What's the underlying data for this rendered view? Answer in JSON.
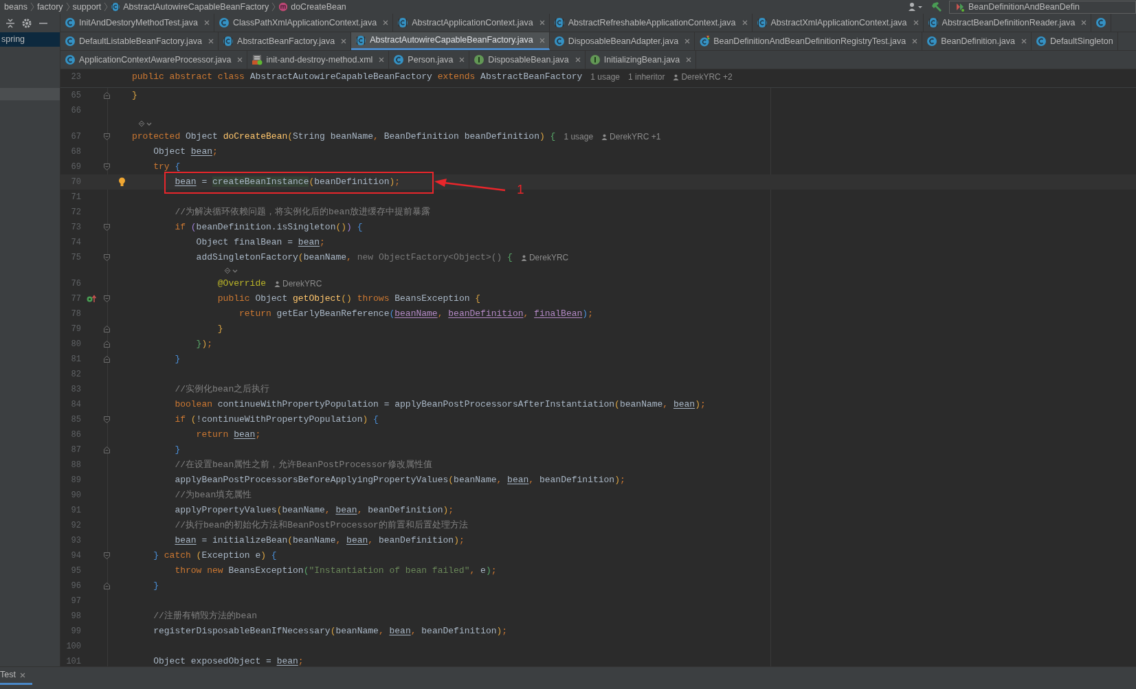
{
  "breadcrumb": [
    {
      "label": "beans"
    },
    {
      "label": "factory"
    },
    {
      "label": "support"
    },
    {
      "label": "AbstractAutowireCapableBeanFactory",
      "kind": "abstract"
    },
    {
      "label": "doCreateBean",
      "kind": "method"
    }
  ],
  "toolbar": {
    "run_config": "BeanDefinitionAndBeanDefin"
  },
  "project_panel": {
    "items": [
      {
        "label": "spring",
        "selected": true
      }
    ]
  },
  "tab_rows": [
    [
      {
        "label": "InitAndDestoryMethodTest.java",
        "kind": "class",
        "selected": false
      },
      {
        "label": "ClassPathXmlApplicationContext.java",
        "kind": "class",
        "selected": false
      },
      {
        "label": "AbstractApplicationContext.java",
        "kind": "abstract",
        "selected": false
      },
      {
        "label": "AbstractRefreshableApplicationContext.java",
        "kind": "abstract",
        "selected": false
      },
      {
        "label": "AbstractXmlApplicationContext.java",
        "kind": "abstract",
        "selected": false
      },
      {
        "label": "AbstractBeanDefinitionReader.java",
        "kind": "abstract",
        "selected": false
      },
      {
        "kind": "class",
        "selected": false
      }
    ],
    [
      {
        "label": "DefaultListableBeanFactory.java",
        "kind": "class",
        "selected": false
      },
      {
        "label": "AbstractBeanFactory.java",
        "kind": "abstract",
        "selected": false
      },
      {
        "label": "AbstractAutowireCapableBeanFactory.java",
        "kind": "abstract",
        "selected": true
      },
      {
        "label": "DisposableBeanAdapter.java",
        "kind": "class",
        "selected": false
      },
      {
        "label": "BeanDefinitionAndBeanDefinitionRegistryTest.java",
        "kind": "test",
        "selected": false
      },
      {
        "label": "BeanDefinition.java",
        "kind": "class",
        "selected": false
      },
      {
        "label": "DefaultSingleton",
        "kind": "class",
        "selected": false
      }
    ],
    [
      {
        "label": "ApplicationContextAwareProcessor.java",
        "kind": "class",
        "selected": false
      },
      {
        "label": "init-and-destroy-method.xml",
        "kind": "xml",
        "selected": false
      },
      {
        "label": "Person.java",
        "kind": "class",
        "selected": false
      },
      {
        "label": "DisposableBean.java",
        "kind": "interface",
        "selected": false
      },
      {
        "label": "InitializingBean.java",
        "kind": "interface",
        "selected": false
      }
    ]
  ],
  "editor": {
    "sticky_lines": [
      {
        "number": "23",
        "tokens": [
          {
            "kind": "keyword",
            "text": "public abstract class "
          },
          {
            "kind": "plain",
            "text": "AbstractAutowireCapableBeanFactory "
          },
          {
            "kind": "keyword",
            "text": "extends "
          },
          {
            "kind": "plain",
            "text": "AbstractBeanFactory"
          }
        ],
        "hints": [
          {
            "kind": "usage",
            "text": "1 usage"
          },
          {
            "kind": "usage",
            "text": "1 inheritor"
          },
          {
            "kind": "author",
            "text": "DerekYRC +2"
          }
        ]
      }
    ],
    "lines": [
      {
        "number": "65",
        "fold": {
          "kind": "end"
        },
        "tokens": [
          {
            "kind": "yellow",
            "text": "}"
          }
        ]
      },
      {
        "number": "66"
      },
      {
        "kind": "widget"
      },
      {
        "number": "67",
        "fold": {
          "kind": "start"
        },
        "tokens": [
          {
            "kind": "keyword",
            "text": "protected "
          },
          {
            "kind": "plain",
            "text": "Object "
          },
          {
            "kind": "method",
            "text": "doCreateBean"
          },
          {
            "kind": "yellow",
            "text": "("
          },
          {
            "kind": "plain",
            "text": "String beanName"
          },
          {
            "kind": "keyword",
            "text": ", "
          },
          {
            "kind": "plain",
            "text": "BeanDefinition beanDefinition"
          },
          {
            "kind": "yellow",
            "text": ")"
          },
          {
            "kind": "green",
            "text": " {"
          }
        ],
        "hints": [
          {
            "kind": "usage",
            "text": "1 usage"
          },
          {
            "kind": "author",
            "text": "DerekYRC +1"
          }
        ]
      },
      {
        "number": "68",
        "tokens": [
          {
            "kind": "plain",
            "text": "    Object "
          },
          {
            "kind": "local",
            "text": "bean"
          },
          {
            "kind": "keyword",
            "text": ";"
          }
        ]
      },
      {
        "number": "69",
        "fold": {
          "kind": "start"
        },
        "tokens": [
          {
            "kind": "keyword",
            "text": "    try "
          },
          {
            "kind": "blue",
            "text": "{"
          }
        ]
      },
      {
        "number": "70",
        "current": true,
        "marker": {
          "kind": "bulb"
        },
        "callout": "1",
        "tokens": [
          {
            "kind": "local",
            "text": "        bean"
          },
          {
            "kind": "plain",
            "text": " = "
          },
          {
            "kind": "highlight",
            "text": "createBeanInstance"
          },
          {
            "kind": "yellow",
            "text": "("
          },
          {
            "kind": "plain",
            "text": "beanDefinition"
          },
          {
            "kind": "yellow",
            "text": ")"
          },
          {
            "kind": "keyword",
            "text": ";"
          }
        ]
      },
      {
        "number": "71"
      },
      {
        "number": "72",
        "tokens": [
          {
            "kind": "comment",
            "text": "        //为解决循环依赖问题，将实例化后的bean放进缓存中提前暴露"
          }
        ]
      },
      {
        "number": "73",
        "fold": {
          "kind": "start"
        },
        "tokens": [
          {
            "kind": "keyword",
            "text": "        if "
          },
          {
            "kind": "purple",
            "text": "("
          },
          {
            "kind": "plain",
            "text": "beanDefinition.isSingleton"
          },
          {
            "kind": "yellow",
            "text": "()"
          },
          {
            "kind": "purple",
            "text": ")"
          },
          {
            "kind": "blue",
            "text": " {"
          }
        ]
      },
      {
        "number": "74",
        "tokens": [
          {
            "kind": "plain",
            "text": "            Object finalBean = "
          },
          {
            "kind": "local",
            "text": "bean"
          },
          {
            "kind": "keyword",
            "text": ";"
          }
        ]
      },
      {
        "number": "75",
        "fold": {
          "kind": "start"
        },
        "tokens": [
          {
            "kind": "plain",
            "text": "            addSingletonFactory"
          },
          {
            "kind": "yellow",
            "text": "("
          },
          {
            "kind": "plain",
            "text": "beanName"
          },
          {
            "kind": "keyword",
            "text": ", "
          },
          {
            "kind": "faded",
            "text": "new ObjectFactory<Object>()"
          },
          {
            "kind": "green",
            "text": " {"
          }
        ],
        "hints": [
          {
            "kind": "author",
            "text": "DerekYRC"
          }
        ]
      },
      {
        "kind": "widget"
      },
      {
        "number": "76",
        "tokens": [
          {
            "kind": "annotation",
            "text": "                @Override"
          }
        ],
        "hints": [
          {
            "kind": "author",
            "text": "DerekYRC"
          }
        ]
      },
      {
        "number": "77",
        "fold": {
          "kind": "start"
        },
        "marker": {
          "kind": "override"
        },
        "tokens": [
          {
            "kind": "keyword",
            "text": "                public "
          },
          {
            "kind": "plain",
            "text": "Object "
          },
          {
            "kind": "method",
            "text": "getObject"
          },
          {
            "kind": "yellow",
            "text": "()"
          },
          {
            "kind": "keyword",
            "text": " throws "
          },
          {
            "kind": "plain",
            "text": "BeansException "
          },
          {
            "kind": "yellow",
            "text": "{"
          }
        ]
      },
      {
        "number": "78",
        "tokens": [
          {
            "kind": "keyword",
            "text": "                    return "
          },
          {
            "kind": "plain",
            "text": "getEarlyBeanReference"
          },
          {
            "kind": "blue",
            "text": "("
          },
          {
            "kind": "captured",
            "text": "beanName"
          },
          {
            "kind": "keyword",
            "text": ", "
          },
          {
            "kind": "captured",
            "text": "beanDefinition"
          },
          {
            "kind": "keyword",
            "text": ", "
          },
          {
            "kind": "captured",
            "text": "finalBean"
          },
          {
            "kind": "blue",
            "text": ")"
          },
          {
            "kind": "keyword",
            "text": ";"
          }
        ]
      },
      {
        "number": "79",
        "fold": {
          "kind": "end"
        },
        "tokens": [
          {
            "kind": "yellow",
            "text": "                }"
          }
        ]
      },
      {
        "number": "80",
        "fold": {
          "kind": "end"
        },
        "tokens": [
          {
            "kind": "green",
            "text": "            }"
          },
          {
            "kind": "yellow",
            "text": ")"
          },
          {
            "kind": "keyword",
            "text": ";"
          }
        ]
      },
      {
        "number": "81",
        "fold": {
          "kind": "end"
        },
        "tokens": [
          {
            "kind": "blue",
            "text": "        }"
          }
        ]
      },
      {
        "number": "82"
      },
      {
        "number": "83",
        "tokens": [
          {
            "kind": "comment",
            "text": "        //实例化bean之后执行"
          }
        ]
      },
      {
        "number": "84",
        "tokens": [
          {
            "kind": "keyword",
            "text": "        boolean "
          },
          {
            "kind": "plain",
            "text": "continueWithPropertyPopulation = applyBeanPostProcessorsAfterInstantiation"
          },
          {
            "kind": "yellow",
            "text": "("
          },
          {
            "kind": "plain",
            "text": "beanName"
          },
          {
            "kind": "keyword",
            "text": ", "
          },
          {
            "kind": "local",
            "text": "bean"
          },
          {
            "kind": "yellow",
            "text": ")"
          },
          {
            "kind": "keyword",
            "text": ";"
          }
        ]
      },
      {
        "number": "85",
        "fold": {
          "kind": "start"
        },
        "tokens": [
          {
            "kind": "keyword",
            "text": "        if "
          },
          {
            "kind": "yellow",
            "text": "("
          },
          {
            "kind": "plain",
            "text": "!continueWithPropertyPopulation"
          },
          {
            "kind": "yellow",
            "text": ")"
          },
          {
            "kind": "blue",
            "text": " {"
          }
        ]
      },
      {
        "number": "86",
        "tokens": [
          {
            "kind": "keyword",
            "text": "            return "
          },
          {
            "kind": "local",
            "text": "bean"
          },
          {
            "kind": "keyword",
            "text": ";"
          }
        ]
      },
      {
        "number": "87",
        "fold": {
          "kind": "end"
        },
        "tokens": [
          {
            "kind": "blue",
            "text": "        }"
          }
        ]
      },
      {
        "number": "88",
        "tokens": [
          {
            "kind": "comment",
            "text": "        //在设置bean属性之前，允许BeanPostProcessor修改属性值"
          }
        ]
      },
      {
        "number": "89",
        "tokens": [
          {
            "kind": "plain",
            "text": "        applyBeanPostProcessorsBeforeApplyingPropertyValues"
          },
          {
            "kind": "yellow",
            "text": "("
          },
          {
            "kind": "plain",
            "text": "beanName"
          },
          {
            "kind": "keyword",
            "text": ", "
          },
          {
            "kind": "local",
            "text": "bean"
          },
          {
            "kind": "keyword",
            "text": ", "
          },
          {
            "kind": "plain",
            "text": "beanDefinition"
          },
          {
            "kind": "yellow",
            "text": ")"
          },
          {
            "kind": "keyword",
            "text": ";"
          }
        ]
      },
      {
        "number": "90",
        "tokens": [
          {
            "kind": "comment",
            "text": "        //为bean填充属性"
          }
        ]
      },
      {
        "number": "91",
        "tokens": [
          {
            "kind": "plain",
            "text": "        applyPropertyValues"
          },
          {
            "kind": "yellow",
            "text": "("
          },
          {
            "kind": "plain",
            "text": "beanName"
          },
          {
            "kind": "keyword",
            "text": ", "
          },
          {
            "kind": "local",
            "text": "bean"
          },
          {
            "kind": "keyword",
            "text": ", "
          },
          {
            "kind": "plain",
            "text": "beanDefinition"
          },
          {
            "kind": "yellow",
            "text": ")"
          },
          {
            "kind": "keyword",
            "text": ";"
          }
        ]
      },
      {
        "number": "92",
        "tokens": [
          {
            "kind": "comment",
            "text": "        //执行bean的初始化方法和BeanPostProcessor的前置和后置处理方法"
          }
        ]
      },
      {
        "number": "93",
        "tokens": [
          {
            "kind": "local",
            "text": "        bean"
          },
          {
            "kind": "plain",
            "text": " = initializeBean"
          },
          {
            "kind": "yellow",
            "text": "("
          },
          {
            "kind": "plain",
            "text": "beanName"
          },
          {
            "kind": "keyword",
            "text": ", "
          },
          {
            "kind": "local",
            "text": "bean"
          },
          {
            "kind": "keyword",
            "text": ", "
          },
          {
            "kind": "plain",
            "text": "beanDefinition"
          },
          {
            "kind": "yellow",
            "text": ")"
          },
          {
            "kind": "keyword",
            "text": ";"
          }
        ]
      },
      {
        "number": "94",
        "fold": {
          "kind": "start"
        },
        "tokens": [
          {
            "kind": "blue",
            "text": "    } "
          },
          {
            "kind": "keyword",
            "text": "catch "
          },
          {
            "kind": "yellow",
            "text": "("
          },
          {
            "kind": "plain",
            "text": "Exception e"
          },
          {
            "kind": "yellow",
            "text": ")"
          },
          {
            "kind": "blue",
            "text": " {"
          }
        ]
      },
      {
        "number": "95",
        "tokens": [
          {
            "kind": "keyword",
            "text": "        throw new "
          },
          {
            "kind": "plain",
            "text": "BeansException"
          },
          {
            "kind": "green",
            "text": "("
          },
          {
            "kind": "string",
            "text": "\"Instantiation of bean failed\""
          },
          {
            "kind": "keyword",
            "text": ", "
          },
          {
            "kind": "plain",
            "text": "e"
          },
          {
            "kind": "green",
            "text": ")"
          },
          {
            "kind": "keyword",
            "text": ";"
          }
        ]
      },
      {
        "number": "96",
        "fold": {
          "kind": "end"
        },
        "tokens": [
          {
            "kind": "blue",
            "text": "    }"
          }
        ]
      },
      {
        "number": "97"
      },
      {
        "number": "98",
        "tokens": [
          {
            "kind": "comment",
            "text": "    //注册有销毁方法的bean"
          }
        ]
      },
      {
        "number": "99",
        "tokens": [
          {
            "kind": "plain",
            "text": "    registerDisposableBeanIfNecessary"
          },
          {
            "kind": "yellow",
            "text": "("
          },
          {
            "kind": "plain",
            "text": "beanName"
          },
          {
            "kind": "keyword",
            "text": ", "
          },
          {
            "kind": "local",
            "text": "bean"
          },
          {
            "kind": "keyword",
            "text": ", "
          },
          {
            "kind": "plain",
            "text": "beanDefinition"
          },
          {
            "kind": "yellow",
            "text": ")"
          },
          {
            "kind": "keyword",
            "text": ";"
          }
        ]
      },
      {
        "number": "100"
      },
      {
        "number": "101",
        "tokens": [
          {
            "kind": "plain",
            "text": "    Object exposedObject = "
          },
          {
            "kind": "local",
            "text": "bean"
          },
          {
            "kind": "keyword",
            "text": ";"
          }
        ]
      }
    ]
  },
  "bottom_tab": {
    "label": "Test"
  }
}
